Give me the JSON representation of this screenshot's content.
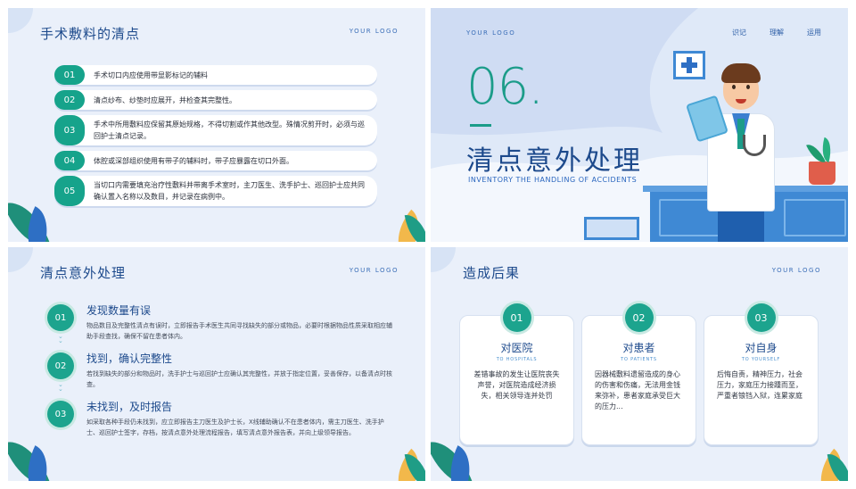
{
  "slide1": {
    "title": "手术敷料的清点",
    "logo": "YOUR LOGO",
    "items": [
      {
        "num": "01",
        "text": "手术切口内应使用带显影标记的辅料"
      },
      {
        "num": "02",
        "text": "清点纱布、纱垫时应展开，并检查其完整性。"
      },
      {
        "num": "03",
        "text": "手术中所用敷料应保留其原始规格，不得切割或作其他改型。殊情况剪开时，必须与巡回护士清点记录。"
      },
      {
        "num": "04",
        "text": "体腔或深部组织使用有带子的辅料时，带子应暴露在切口外面。"
      },
      {
        "num": "05",
        "text": "当切口内需要填充治疗性敷料并带离手术室时，主刀医生、洗手护士、巡回护士应共同确认置入名称以及数目，并记录在病例中。"
      }
    ]
  },
  "slide2": {
    "logo": "YOUR LOGO",
    "nav": [
      "识记",
      "理解",
      "运用"
    ],
    "number": "06.",
    "title": "清点意外处理",
    "subtitle": "INVENTORY THE HANDLING OF ACCIDENTS"
  },
  "slide3": {
    "title": "清点意外处理",
    "logo": "YOUR LOGO",
    "steps": [
      {
        "num": "01",
        "title": "发现数量有误",
        "desc": "物品数目及完整性清点有误时，立即报告手术医生共同寻找缺失的部分或物品，必要时根据物品性质采取相应辅助手段查找，确保不留在患者体内。"
      },
      {
        "num": "02",
        "title": "找到，确认完整性",
        "desc": "若找到缺失的部分和物品时，洗手护士与巡回护士应确认其完整性，并放于指定位置，妥善保存，以备清点时核查。"
      },
      {
        "num": "03",
        "title": "未找到，及时报告",
        "desc": "如采取各种手段仍未找到，应立即报告主刀医生及护士长，X线辅助确认不在患者体内，需主刀医生、洗手护士、巡回护士签字，存档，按清点意外处理流程报告，填写清点意外报告表，并向上级领导报告。"
      }
    ]
  },
  "slide4": {
    "title": "造成后果",
    "logo": "YOUR LOGO",
    "cards": [
      {
        "num": "01",
        "title": "对医院",
        "sub": "TO HOSPITALS",
        "body": "差错事故的发生让医院丧失声誉，对医院造成经济损失，相关领导连并处罚"
      },
      {
        "num": "02",
        "title": "对患者",
        "sub": "TO PATIENTS",
        "body": "因器械敷料遗留造成的身心的伤害和伤痛，无法用金钱来弥补，患者家庭承受巨大的压力..."
      },
      {
        "num": "03",
        "title": "对自身",
        "sub": "TO YOURSELF",
        "body": "后悔自责，精神压力，社会压力，家庭压力接踵而至，严重者锒铛入狱，连累家庭"
      }
    ]
  }
}
